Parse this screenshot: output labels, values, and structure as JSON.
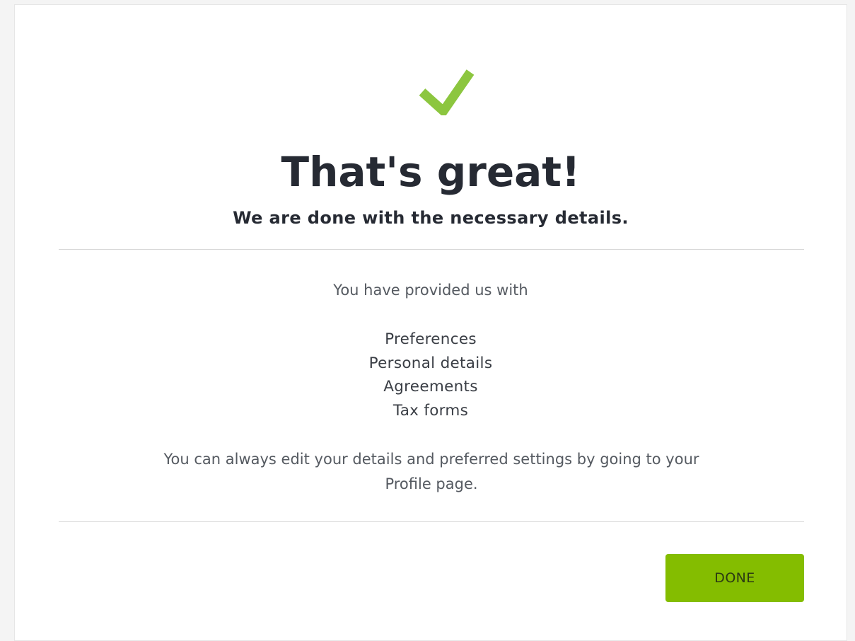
{
  "dialog": {
    "icon": "checkmark-icon",
    "accent_color": "#84bd00",
    "title": "That's great!",
    "subtitle": "We are done with the necessary details.",
    "intro": "You have provided us with",
    "items": [
      {
        "label": "Preferences"
      },
      {
        "label": "Personal details"
      },
      {
        "label": "Agreements"
      },
      {
        "label": "Tax forms"
      }
    ],
    "note": "You can always edit your details and preferred settings by going to your Profile page.",
    "done_label": "DONE"
  }
}
